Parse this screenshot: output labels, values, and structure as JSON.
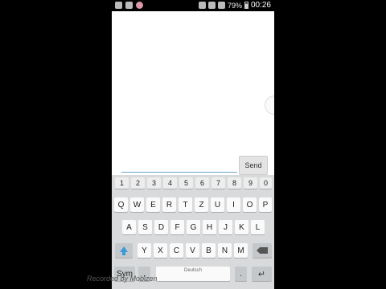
{
  "status_bar": {
    "battery_percent": "79%",
    "time": "00:26",
    "icons": [
      "email-icon",
      "download-icon",
      "app-avatar-icon",
      "mute-icon",
      "wifi-icon",
      "signal-icon",
      "battery-icon"
    ]
  },
  "chat": {
    "message_value": "",
    "send_label": "Send"
  },
  "keyboard": {
    "number_row": [
      "1",
      "2",
      "3",
      "4",
      "5",
      "6",
      "7",
      "8",
      "9",
      "0"
    ],
    "row1": [
      "Q",
      "W",
      "E",
      "R",
      "T",
      "Z",
      "U",
      "I",
      "O",
      "P"
    ],
    "row2": [
      "A",
      "S",
      "D",
      "F",
      "G",
      "H",
      "J",
      "K",
      "L"
    ],
    "row3": [
      "Y",
      "X",
      "C",
      "V",
      "B",
      "N",
      "M"
    ],
    "sym_label": "Sym",
    "punct_label": ",",
    "space_label": "Deutsch",
    "period_label": "."
  },
  "watermark": "Recorded by Mobizen"
}
